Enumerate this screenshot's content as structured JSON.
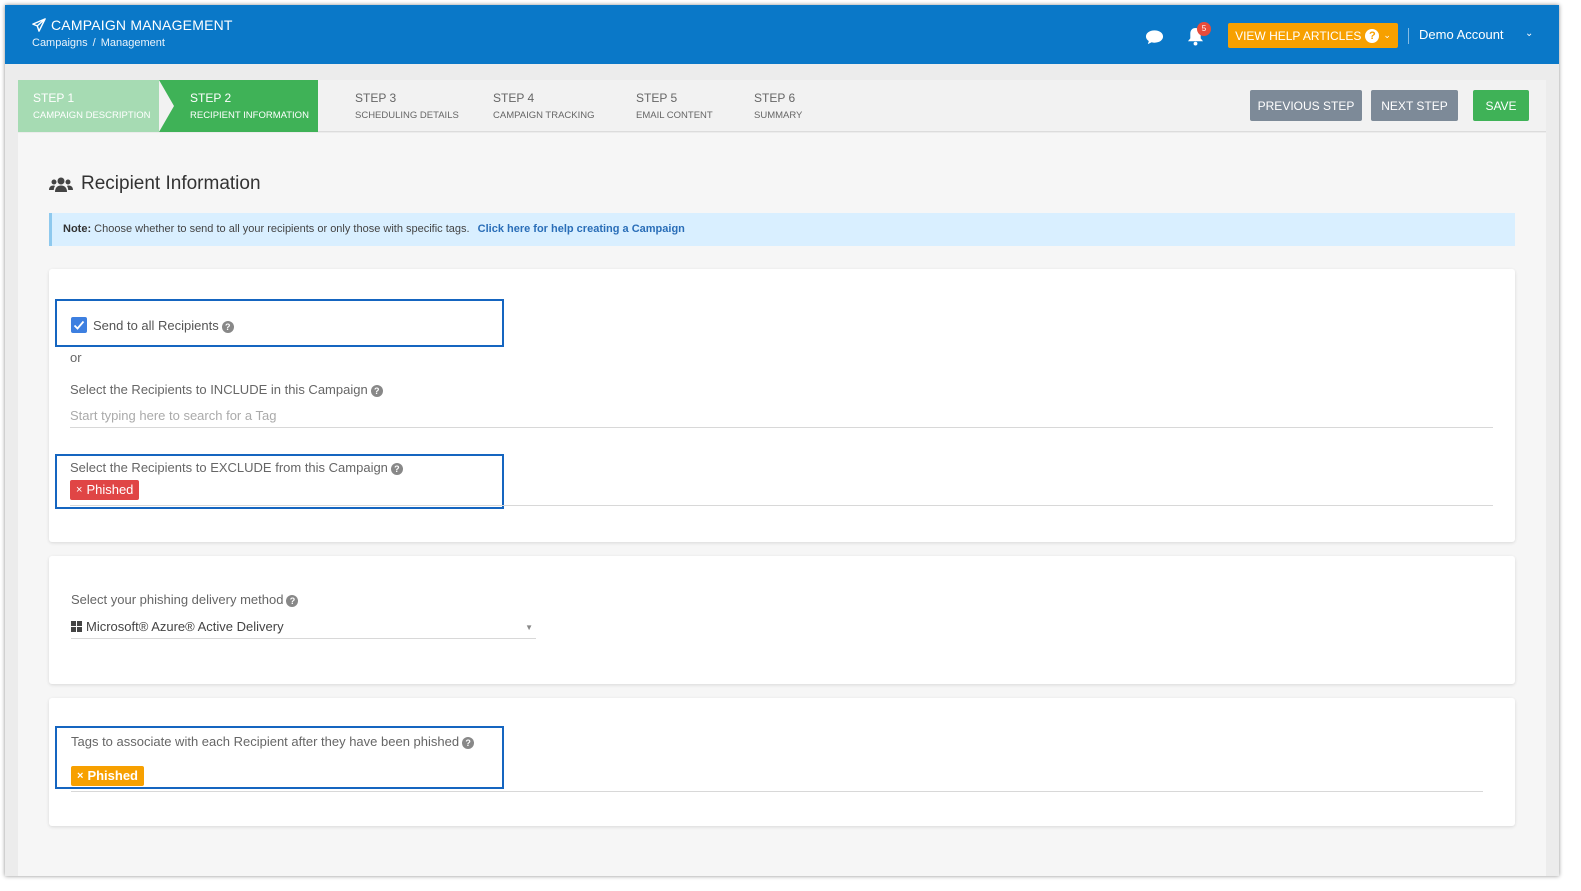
{
  "header": {
    "title": "CAMPAIGN MANAGEMENT",
    "breadcrumb": [
      "Campaigns",
      "/",
      "Management"
    ],
    "notification_count": "5",
    "help_button": "VIEW HELP ARTICLES",
    "account": "Demo Account",
    "color": "#0a78c8"
  },
  "steps": [
    {
      "num": "STEP 1",
      "label": "CAMPAIGN DESCRIPTION",
      "state": "done"
    },
    {
      "num": "STEP 2",
      "label": "RECIPIENT INFORMATION",
      "state": "active"
    },
    {
      "num": "STEP 3",
      "label": "SCHEDULING DETAILS",
      "state": "todo"
    },
    {
      "num": "STEP 4",
      "label": "CAMPAIGN TRACKING",
      "state": "todo"
    },
    {
      "num": "STEP 5",
      "label": "EMAIL CONTENT",
      "state": "todo"
    },
    {
      "num": "STEP 6",
      "label": "SUMMARY",
      "state": "todo"
    }
  ],
  "actions": {
    "previous": "PREVIOUS STEP",
    "next": "NEXT STEP",
    "save": "SAVE"
  },
  "page": {
    "title": "Recipient Information",
    "note_prefix": "Note:",
    "note_text": "Choose whether to send to all your recipients or only those with specific tags.",
    "note_link": "Click here for help creating a Campaign"
  },
  "recipients": {
    "send_all_label": "Send to all Recipients",
    "send_all_checked": true,
    "or": "or",
    "include_label": "Select the Recipients to INCLUDE in this Campaign",
    "include_placeholder": "Start typing here to search for a Tag",
    "exclude_label": "Select the Recipients to EXCLUDE from this Campaign",
    "exclude_tag": "Phished"
  },
  "delivery": {
    "label": "Select your phishing delivery method",
    "selected": "Microsoft® Azure® Active Delivery"
  },
  "post_tags": {
    "label": "Tags to associate with each Recipient after they have been phished",
    "tag": "Phished"
  }
}
